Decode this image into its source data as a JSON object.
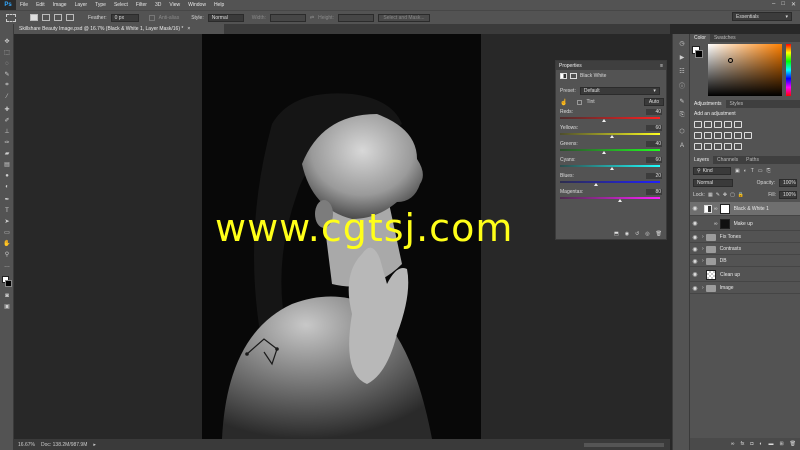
{
  "menu": {
    "logo": "Ps",
    "items": [
      "File",
      "Edit",
      "Image",
      "Layer",
      "Type",
      "Select",
      "Filter",
      "3D",
      "View",
      "Window",
      "Help"
    ],
    "window_controls": [
      "–",
      "□",
      "✕"
    ]
  },
  "options": {
    "feather_label": "Feather:",
    "feather_value": "0 px",
    "anti_alias_label": "Anti-alias",
    "style_label": "Style:",
    "style_value": "Normal",
    "width_label": "Width:",
    "height_label": "Height:",
    "select_mask_label": "Select and Mask...",
    "workspace": "Essentials"
  },
  "document": {
    "tab_title": "Skillshare Beauty Image.psd @ 16.7% (Black & White 1, Layer Mask/16) *",
    "tab_close": "×"
  },
  "status": {
    "zoom": "16.67%",
    "doc": "Doc: 138.2M/987.9M",
    "arrow": "▸"
  },
  "watermark": "www.cgtsj.com",
  "properties": {
    "title": "Properties",
    "menu_icon": "≡",
    "adjustment_name": "Black  White",
    "preset_label": "Preset:",
    "preset_value": "Default",
    "tint_label": "Tint",
    "auto_label": "Auto",
    "sliders": [
      {
        "label": "Reds:",
        "value": "40",
        "level": 0.44,
        "gradient": "linear-gradient(90deg,#4d2d2d,#ff2020)"
      },
      {
        "label": "Yellows:",
        "value": "60",
        "level": 0.52,
        "gradient": "linear-gradient(90deg,#4d4d2d,#ffff20)"
      },
      {
        "label": "Greens:",
        "value": "40",
        "level": 0.44,
        "gradient": "linear-gradient(90deg,#2d4d2d,#20ff20)"
      },
      {
        "label": "Cyans:",
        "value": "60",
        "level": 0.52,
        "gradient": "linear-gradient(90deg,#2d4d4d,#20ffff)"
      },
      {
        "label": "Blues:",
        "value": "20",
        "level": 0.36,
        "gradient": "linear-gradient(90deg,#2d2d4d,#2020ff)"
      },
      {
        "label": "Magentas:",
        "value": "80",
        "level": 0.6,
        "gradient": "linear-gradient(90deg,#4d2d4d,#ff20ff)"
      }
    ]
  },
  "color_panel": {
    "tabs": [
      "Color",
      "Swatches"
    ],
    "hue_color": "#ff8000"
  },
  "adjustments_panel": {
    "tabs": [
      "Adjustments",
      "Styles"
    ],
    "add_label": "Add an adjustment"
  },
  "layers_panel": {
    "tabs": [
      "Layers",
      "Channels",
      "Paths"
    ],
    "kind_label": "Kind",
    "blend_mode": "Normal",
    "opacity_label": "Opacity:",
    "opacity_value": "100%",
    "lock_label": "Lock:",
    "fill_label": "Fill:",
    "fill_value": "100%",
    "layers": [
      {
        "name": "Black & White 1",
        "type": "adjustment",
        "selected": true
      },
      {
        "name": "Make up",
        "type": "mask",
        "selected": false
      },
      {
        "name": "Fix Tones",
        "type": "folder",
        "selected": false
      },
      {
        "name": "Contrasts",
        "type": "folder",
        "selected": false
      },
      {
        "name": "DB",
        "type": "folder",
        "selected": false
      },
      {
        "name": "Clean up",
        "type": "pixel",
        "selected": false
      },
      {
        "name": "Image",
        "type": "folder",
        "selected": false
      }
    ]
  }
}
